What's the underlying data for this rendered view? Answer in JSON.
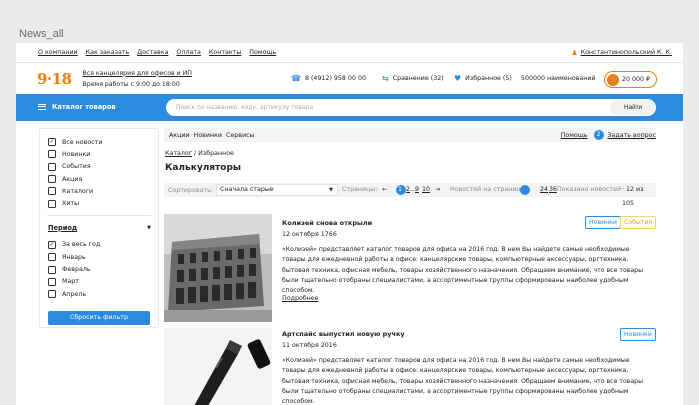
{
  "page_label": "News_all",
  "topnav": {
    "links": [
      "О компании",
      "Как заказать",
      "Доставка",
      "Оплата",
      "Контакты",
      "Помощь"
    ],
    "user_name": "Константинопольский К. К."
  },
  "header": {
    "logo": "9·18",
    "tagline": "Вся канцелярия для офисов и ИП",
    "hours": "Время работы с 9:00 до 18:00",
    "phone": "8 (4912) 958 00 00",
    "compare": "Сравнение (32)",
    "favorites": "Избранное (5)",
    "items_count": "500000 наименований",
    "cart_total": "20 000 ₽"
  },
  "bluebar": {
    "catalog_label": "Каталог товаров",
    "search_placeholder": "Поиск по названию, коду, артикулу товара",
    "search_button": "Найти"
  },
  "sidebar": {
    "types": [
      {
        "label": "Все новости",
        "checked": true
      },
      {
        "label": "Новинки",
        "checked": false
      },
      {
        "label": "События",
        "checked": false
      },
      {
        "label": "Акция",
        "checked": false
      },
      {
        "label": "Каталоги",
        "checked": false
      },
      {
        "label": "Хиты",
        "checked": false
      }
    ],
    "period_title": "Период",
    "periods": [
      {
        "label": "За весь год",
        "checked": true
      },
      {
        "label": "Январь",
        "checked": false
      },
      {
        "label": "Февраль",
        "checked": false
      },
      {
        "label": "Март",
        "checked": false
      },
      {
        "label": "Апрель",
        "checked": false
      }
    ],
    "reset_label": "Сбросить фильтр"
  },
  "main": {
    "tabs": [
      "Акции",
      "Новинки",
      "Сервисы"
    ],
    "help": "Помощь",
    "question_count": "2",
    "ask": "Задать вопрос",
    "breadcrumb_link": "Каталог",
    "breadcrumb_current": "Избранное",
    "title": "Калькуляторы",
    "sort_label": "Сортировать:",
    "sort_value": "Сначала старые",
    "pages_label": "Страницы:",
    "pages": {
      "prev": "←",
      "p1": "1",
      "p2": "2",
      "dots": "...",
      "p9": "9",
      "p10": "10",
      "next": "→"
    },
    "per_page_label": "Новостей на странице",
    "per_page_options": [
      "24",
      "36"
    ],
    "shown_label": "Показано новостей",
    "shown_value": "· 12 из 105"
  },
  "news": [
    {
      "title": "Колизей снова открыли",
      "date": "12 октября 1766",
      "text": "«Колизей» представляет каталог товаров для офиса на 2016 год. В нем Вы найдете самые необходимые товары для ежедневной работы в офисе: канцелярские товары, компьютерные аксессуары, оргтехника, бытовая техника, офисная мебель, товары хозяйственного назначения. Обращаем внимание, что все товары были тщательно отобраны специалистами, а ассортиментные группы сформированы наиболее удобным способом.",
      "more": "Подробнее",
      "tags": [
        "Новинки",
        "События"
      ]
    },
    {
      "title": "Артспайс выпустил новую ручку",
      "date": "11 октября 2016",
      "text": "«Колизей» представляет каталог товаров для офиса на 2016 год. В нем Вы найдете самые необходимые товары для ежедневной работы в офисе: канцелярские товары, компьютерные аксессуары, оргтехника, бытовая техника, офисная мебель, товары хозяйственного назначения. Обращаем внимание, что все товары были тщательно отобраны специалистами, а ассортиментные группы сформированы наиболее удобным способом.",
      "tags": [
        "Новинки"
      ]
    }
  ],
  "colors": {
    "accent": "#2b8be0",
    "brand": "#f07d00"
  }
}
